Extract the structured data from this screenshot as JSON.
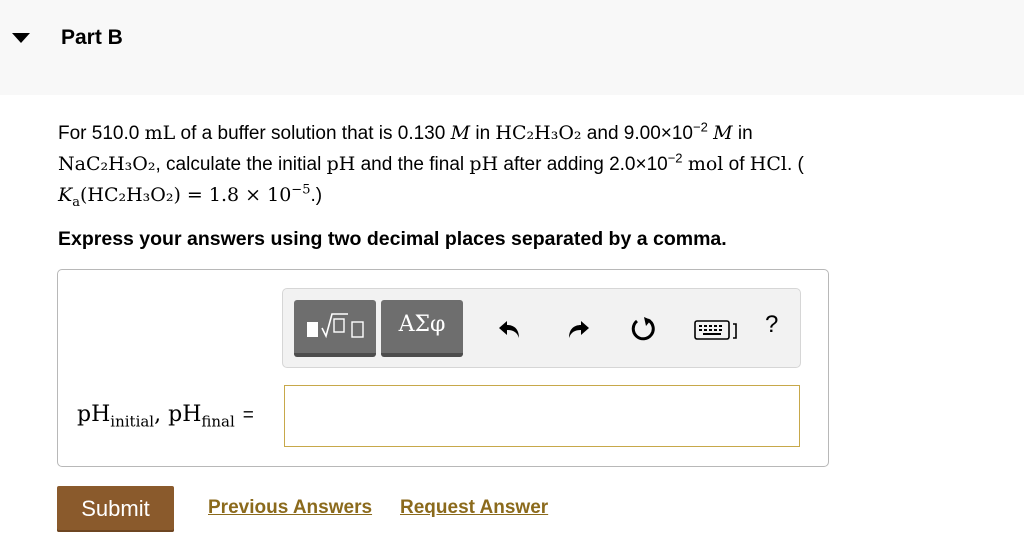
{
  "part": {
    "title": "Part B"
  },
  "question": {
    "text_1": "For 510.0 ",
    "unit_ml": "mL",
    "text_2": " of a buffer solution that is 0.130 ",
    "molarity_symbol": "M",
    "text_3": " in ",
    "acid_formula": "HC₂H₃O₂",
    "text_4": " and 9.00×10",
    "exp_1": "−2",
    "text_5": " ",
    "molarity_symbol_2": "M",
    "text_6": " in",
    "salt_formula": "NaC₂H₃O₂",
    "text_7": ", calculate the initial ",
    "ph_1": "pH",
    "text_8": " and the final ",
    "ph_2": "pH",
    "text_9": " after adding 2.0×10",
    "exp_2": "−2",
    "text_10": " ",
    "unit_mol": "mol",
    "text_11": " of ",
    "hcl": "HCl",
    "text_12": ". (",
    "ka_symbol": "K",
    "ka_sub": "a",
    "ka_expr": "(HC₂H₃O₂) = 1.8 × 10",
    "ka_exp": "−5",
    "text_13": ".)"
  },
  "instruction": "Express your answers using two decimal places separated by a comma.",
  "toolbar": {
    "symbols_label": "ΑΣφ",
    "help_label": "?",
    "tools": [
      "templates-icon",
      "symbols",
      "undo-icon",
      "redo-icon",
      "reset-icon",
      "keyboard-icon",
      "help-icon"
    ]
  },
  "answer": {
    "label_main_1": "pH",
    "label_sub_1": "initial",
    "label_sep": ", ",
    "label_main_2": "pH",
    "label_sub_2": "final",
    "equals": "=",
    "value": ""
  },
  "actions": {
    "submit_label": "Submit",
    "previous_answers_label": "Previous Answers",
    "request_answer_label": "Request Answer"
  },
  "colors": {
    "submit_bg": "#8a5a2c",
    "link": "#8b6a1c",
    "input_border": "#c7a84a",
    "toolbar_button": "#6e6e6e"
  }
}
